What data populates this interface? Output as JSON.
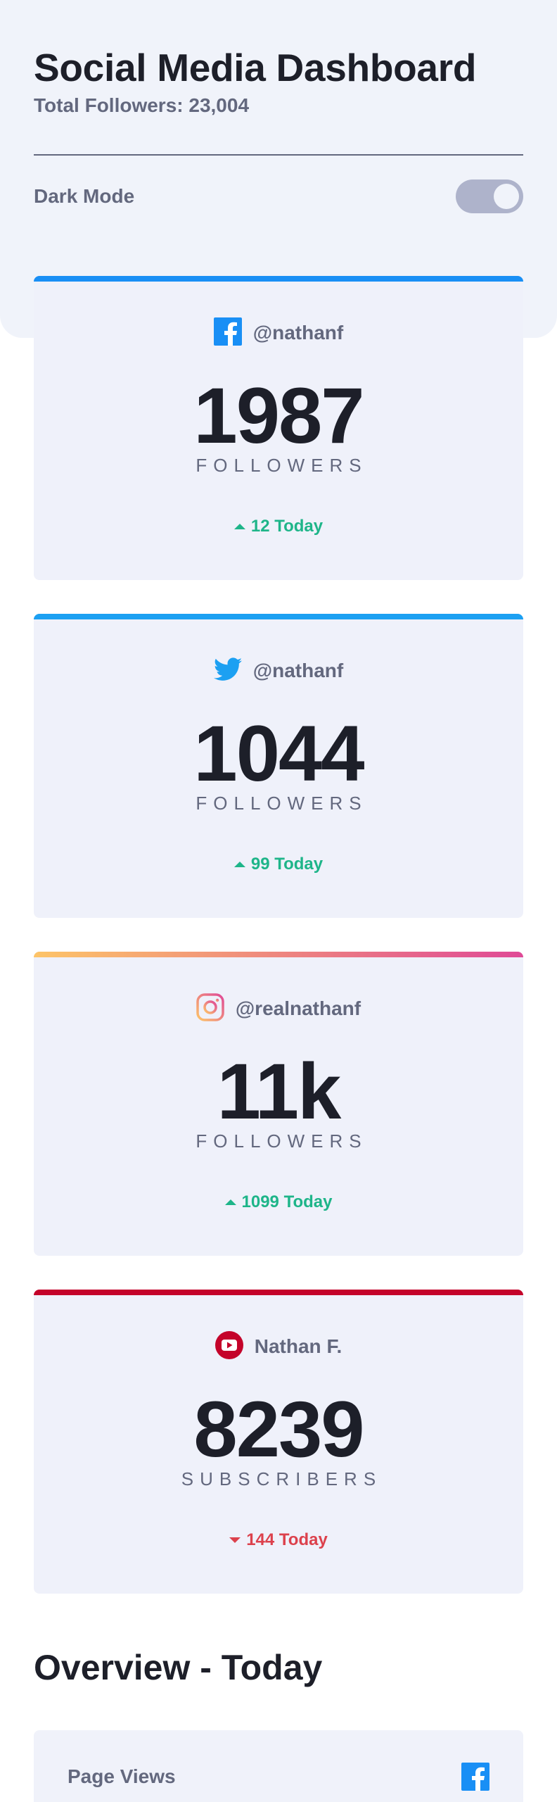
{
  "header": {
    "title": "Social Media Dashboard",
    "total_followers": "Total Followers: 23,004",
    "dark_mode_label": "Dark Mode",
    "dark_mode_on": true
  },
  "cards": [
    {
      "platform": "facebook",
      "icon": "facebook-icon",
      "accent": "#198ff5",
      "handle": "@nathanf",
      "count": "1987",
      "unit": "FOLLOWERS",
      "delta": "12 Today",
      "trend": "up"
    },
    {
      "platform": "twitter",
      "icon": "twitter-icon",
      "accent": "#1ca0f2",
      "handle": "@nathanf",
      "count": "1044",
      "unit": "FOLLOWERS",
      "delta": "99 Today",
      "trend": "up"
    },
    {
      "platform": "instagram",
      "icon": "instagram-icon",
      "accent": "#fdc468",
      "accent2": "#df4996",
      "handle": "@realnathanf",
      "count": "11k",
      "unit": "FOLLOWERS",
      "delta": "1099 Today",
      "trend": "up"
    },
    {
      "platform": "youtube",
      "icon": "youtube-icon",
      "accent": "#c4032a",
      "handle": "Nathan F.",
      "count": "8239",
      "unit": "SUBSCRIBERS",
      "delta": "144 Today",
      "trend": "down"
    }
  ],
  "overview": {
    "title": "Overview - Today",
    "items": [
      {
        "label": "Page Views",
        "icon": "facebook-icon"
      }
    ]
  },
  "colors": {
    "positive": "#1eb589",
    "negative": "#dc414c",
    "text_dark": "#1d1f29",
    "text_muted": "#63687e"
  }
}
